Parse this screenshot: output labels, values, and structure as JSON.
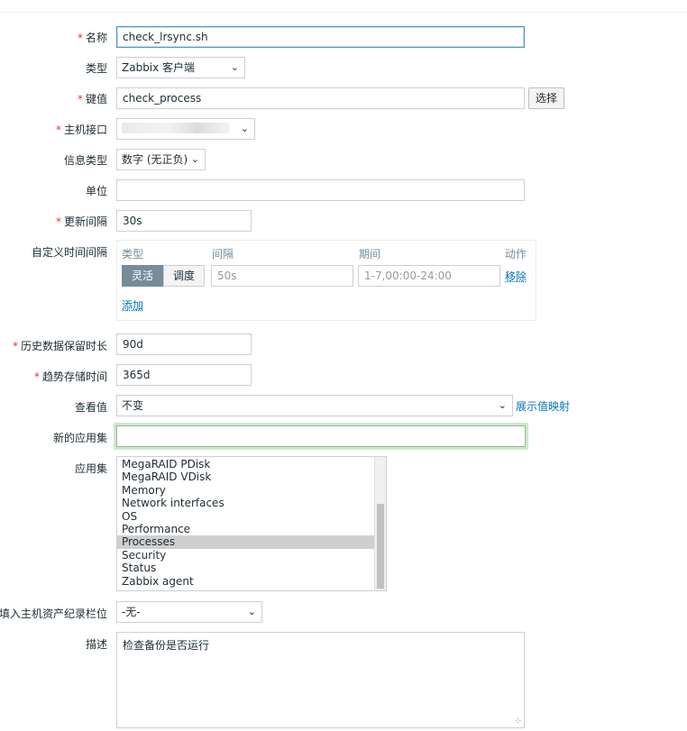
{
  "form": {
    "name": {
      "label": "名称",
      "value": "check_lrsync.sh"
    },
    "type": {
      "label": "类型",
      "value": "Zabbix 客户端"
    },
    "key": {
      "label": "键值",
      "value": "check_process",
      "button": "选择"
    },
    "host_interface": {
      "label": "主机接口",
      "value": ""
    },
    "info_type": {
      "label": "信息类型",
      "value": "数字 (无正负)"
    },
    "units": {
      "label": "单位",
      "value": ""
    },
    "update_interval": {
      "label": "更新间隔",
      "value": "30s"
    },
    "custom_intervals": {
      "label": "自定义时间间隔",
      "headers": {
        "type": "类型",
        "interval": "间隔",
        "period": "期间",
        "action": "动作"
      },
      "row": {
        "flexible_label": "灵活",
        "scheduling_label": "调度",
        "interval_placeholder": "50s",
        "period_placeholder": "1-7,00:00-24:00",
        "remove_label": "移除"
      },
      "add_label": "添加"
    },
    "history": {
      "label": "历史数据保留时长",
      "value": "90d"
    },
    "trends": {
      "label": "趋势存储时间",
      "value": "365d"
    },
    "show_value": {
      "label": "查看值",
      "value": "不变",
      "link": "展示值映射"
    },
    "new_application": {
      "label": "新的应用集",
      "value": ""
    },
    "applications": {
      "label": "应用集",
      "options": [
        "MegaRAID PDisk",
        "MegaRAID VDisk",
        "Memory",
        "Network interfaces",
        "OS",
        "Performance",
        "Processes",
        "Security",
        "Status",
        "Zabbix agent"
      ],
      "selected": "Processes"
    },
    "inventory": {
      "label": "填入主机资产纪录栏位",
      "value": "-无-"
    },
    "description": {
      "label": "描述",
      "value": "检查备份是否运行"
    }
  }
}
